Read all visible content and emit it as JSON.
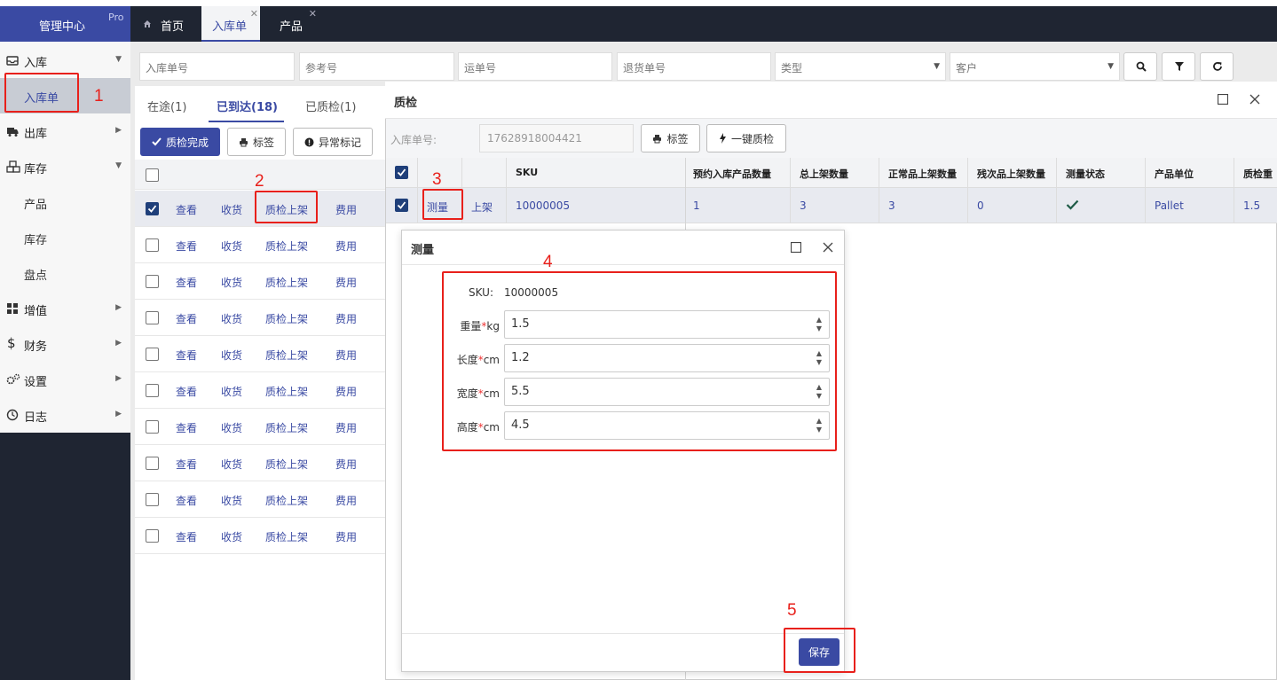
{
  "brand": {
    "name": "管理中心",
    "badge": "Pro"
  },
  "tabs": [
    {
      "label": "首页",
      "icon": "home-icon"
    },
    {
      "label": "入库单",
      "close": "✕"
    },
    {
      "label": "产品",
      "close": "✕"
    }
  ],
  "sidebar": {
    "inbound": "入库",
    "inbound_order": "入库单",
    "outbound": "出库",
    "inventory": "库存",
    "product": "产品",
    "stock": "库存",
    "stocktake": "盘点",
    "value_added": "增值",
    "finance": "财务",
    "settings": "设置",
    "log": "日志"
  },
  "filters": {
    "inbound_no": "入库单号",
    "reference_no": "参考号",
    "waybill_no": "运单号",
    "return_no": "退货单号",
    "type": "类型",
    "customer": "客户"
  },
  "status_tabs": {
    "in_transit": "在途(1)",
    "arrived": "已到达(18)",
    "inspected": "已质检(1)"
  },
  "actions": {
    "qc_complete": "质检完成",
    "label": "标签",
    "exception": "异常标记"
  },
  "row_links": {
    "view": "查看",
    "receive": "收货",
    "qc_shelve": "质检上架",
    "fee": "费用"
  },
  "qc_dialog": {
    "title": "质检",
    "inbound_no_label": "入库单号:",
    "inbound_no_value": "17628918004421",
    "label_btn": "标签",
    "one_click_qc": "一键质检",
    "headers": [
      "SKU",
      "预约入库产品数量",
      "总上架数量",
      "正常品上架数量",
      "残次品上架数量",
      "测量状态",
      "产品单位",
      "质检重"
    ],
    "row": {
      "measure": "测量",
      "shelve": "上架",
      "sku": "10000005",
      "planned_qty": "1",
      "total_shelved": "3",
      "normal_shelved": "3",
      "defect_shelved": "0",
      "unit": "Pallet",
      "qc_weight": "1.5"
    }
  },
  "measure_dialog": {
    "title": "测量",
    "sku_label": "SKU:",
    "sku_value": "10000005",
    "weight_label": "重量",
    "weight_unit": "kg",
    "weight": "1.5",
    "length_label": "长度",
    "length_unit": "cm",
    "length": "1.2",
    "width_label": "宽度",
    "width_unit": "cm",
    "width": "5.5",
    "height_label": "高度",
    "height_unit": "cm",
    "height": "4.5",
    "required_mark": "*",
    "save": "保存"
  },
  "annotations": [
    "1",
    "2",
    "3",
    "4",
    "5"
  ],
  "colors": {
    "accent": "#3a4aa3",
    "dark": "#1f2532",
    "annotation": "#e8201b"
  }
}
